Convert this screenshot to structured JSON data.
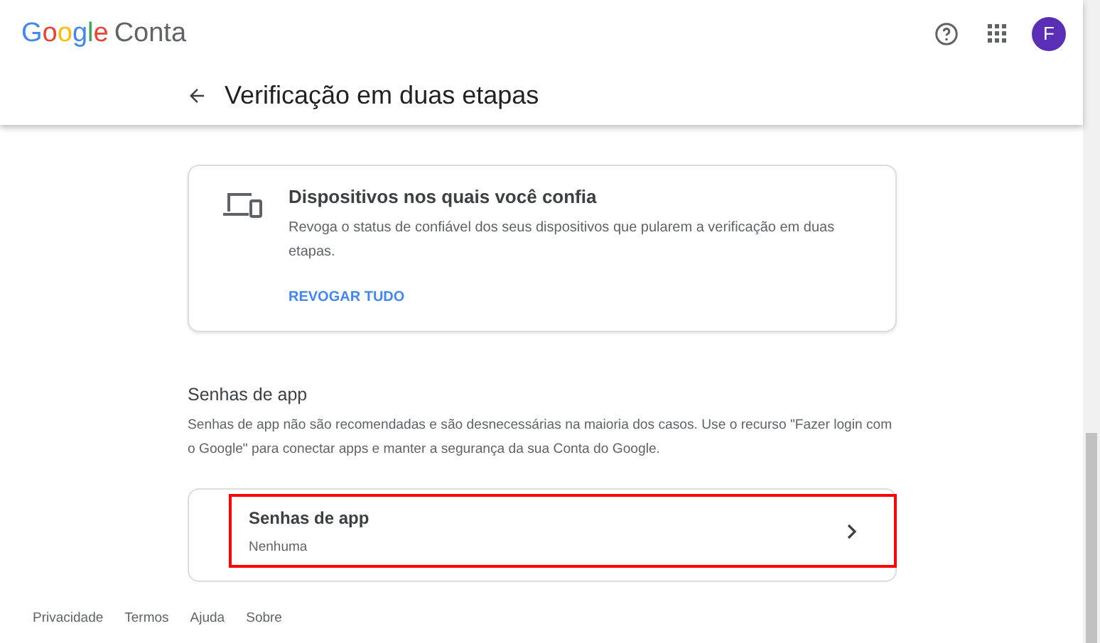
{
  "header": {
    "logo": "Google",
    "product": "Conta",
    "avatar": "F"
  },
  "page_title": "Verificação em duas etapas",
  "devices_card": {
    "title": "Dispositivos nos quais você confia",
    "description": "Revoga o status de confiável dos seus dispositivos que pularem a verificação em duas etapas.",
    "action": "REVOGAR TUDO"
  },
  "app_passwords": {
    "heading": "Senhas de app",
    "description": "Senhas de app não são recomendadas e são desnecessárias na maioria dos casos. Use o recurso \"Fazer login com o Google\" para conectar apps e manter a segurança da sua Conta do Google.",
    "item": {
      "title": "Senhas de app",
      "value": "Nenhuma",
      "highlighted": true
    }
  },
  "footer": [
    "Privacidade",
    "Termos",
    "Ajuda",
    "Sobre"
  ]
}
